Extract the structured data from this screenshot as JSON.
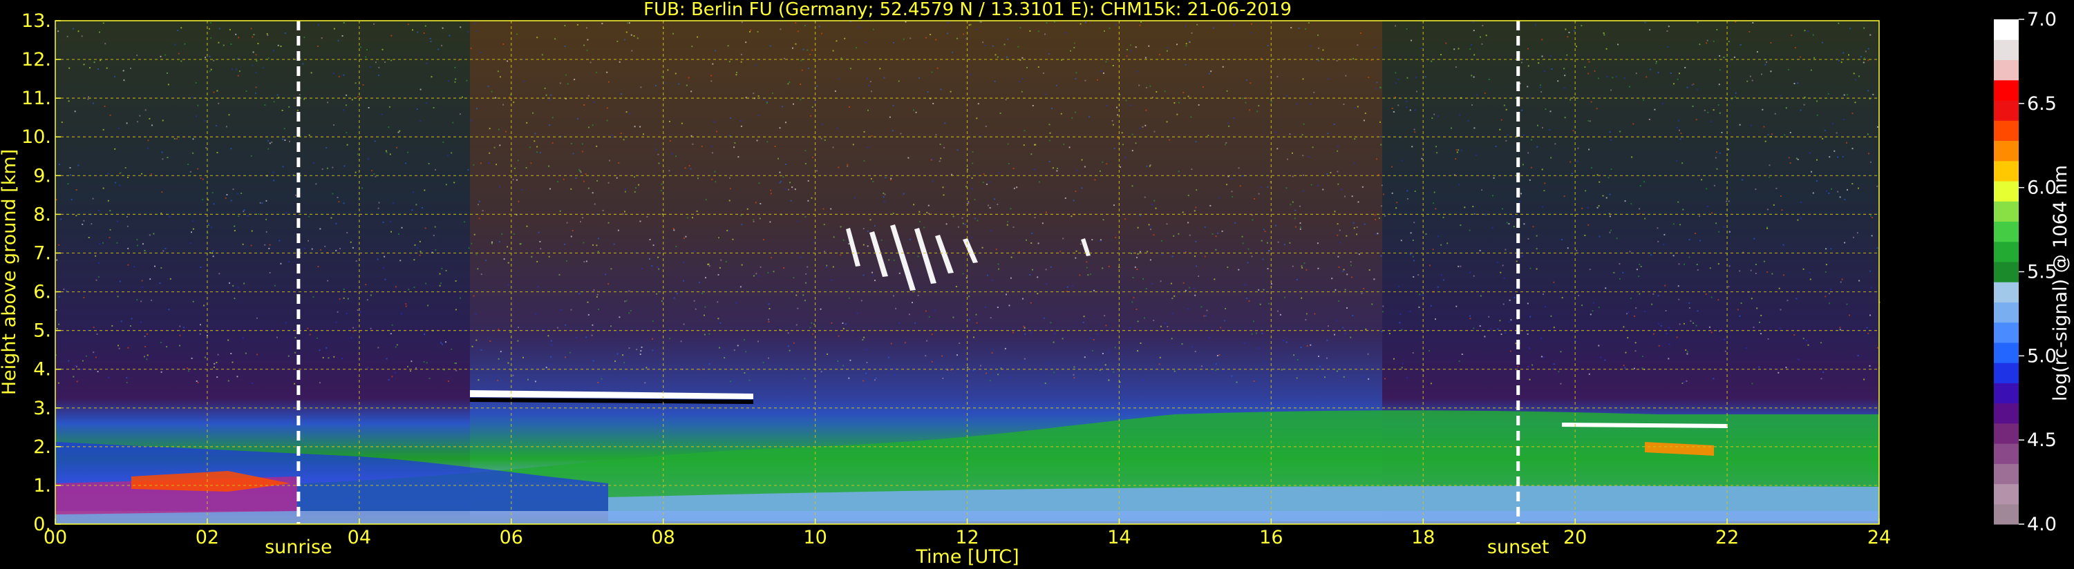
{
  "chart_data": {
    "type": "heatmap",
    "title": "FUB: Berlin FU (Germany; 52.4579 N / 13.3101 E):    CHM15k: 21-06-2019",
    "xlabel": "Time [UTC]",
    "ylabel": "Height above ground [km]",
    "xlim": [
      0,
      24
    ],
    "ylim": [
      0,
      13
    ],
    "x_ticks": [
      0,
      2,
      4,
      6,
      8,
      10,
      12,
      14,
      16,
      18,
      20,
      22,
      24
    ],
    "x_tick_labels": [
      "00",
      "02",
      "04",
      "06",
      "08",
      "10",
      "12",
      "14",
      "16",
      "18",
      "20",
      "22",
      "24"
    ],
    "y_ticks": [
      0,
      1,
      2,
      3,
      4,
      5,
      6,
      7,
      8,
      9,
      10,
      11,
      12,
      13
    ],
    "y_tick_labels": [
      "0.",
      "1.",
      "2.",
      "3.",
      "4.",
      "5.",
      "6.",
      "7.",
      "8.",
      "9.",
      "10.",
      "11.",
      "12.",
      "13."
    ],
    "grid": true,
    "colors": {
      "text": "#ffff33",
      "grid": "#d4c21a",
      "background": "#000000"
    },
    "markers": [
      {
        "label": "sunrise",
        "time": 3.2
      },
      {
        "label": "sunset",
        "time": 19.25
      }
    ],
    "colorbar": {
      "label": "log(rc-signal) @ 1064 nm",
      "range": [
        4.0,
        7.0
      ],
      "ticks": [
        4.0,
        4.5,
        5.0,
        5.5,
        6.0,
        6.5,
        7.0
      ],
      "tick_labels": [
        "4.0",
        "4.5",
        "5.0",
        "5.5",
        "6.0",
        "6.5",
        "7.0"
      ],
      "colors": [
        "#a08898",
        "#b493aa",
        "#9d6f97",
        "#8a4a8a",
        "#74287a",
        "#5a0f8a",
        "#3a0fb3",
        "#1f33e6",
        "#2266ff",
        "#4a8cff",
        "#79aef0",
        "#a1c8e8",
        "#1a8a2a",
        "#22aa33",
        "#44cc44",
        "#88e044",
        "#e6ff33",
        "#ffc800",
        "#ff8c00",
        "#ff4a00",
        "#ee1111",
        "#ff0000",
        "#f0c0c0",
        "#e6e0e0",
        "#ffffff"
      ]
    }
  }
}
